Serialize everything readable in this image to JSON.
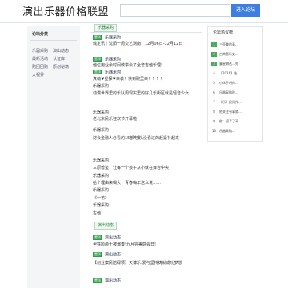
{
  "header": {
    "logo": "演出乐器价格联盟",
    "search_placeholder": "",
    "search_button": "进入论坛"
  },
  "sidebar": {
    "title": "论坛分类",
    "items": [
      "乐器采购",
      "演出动态",
      "最新活动",
      "认证库",
      "赔团团购",
      "原创秘籍",
      "大视界"
    ]
  },
  "section1": {
    "tab": "乐器采购",
    "posts": [
      {
        "tag": "置顶",
        "source": "乐器采购",
        "title": "城定讯｜沈阳一周交艺测南：12月06日-12月12日"
      },
      {
        "tag": "置顶",
        "source": "乐器采购",
        "title": "他位用业余时间教学会了全套吉他乐理!"
      },
      {
        "tag": "置顶",
        "source": "乐器采购",
        "title": "真萌♥星探♥来袭！快到碗里来！！！！"
      },
      {
        "source": "乐器采购",
        "title": "动漫世界里的乐队周现实里的好几乐街区就是轻音少女"
      },
      {
        "source": "乐器采购",
        "title": "老北京民乐狂欢节开幕啦！"
      },
      {
        "source": "乐器采购",
        "title": "财会金融人必看的15部电影,没看过的赶紧补起来"
      },
      {
        "source": "乐器采购",
        "title": "三原兽鉴：让每一个孩子从小就在舞台中央"
      },
      {
        "source": "乐器采购",
        "title": "给个理由来喝大！青春嗨年这么说……"
      },
      {
        "source": "乐器采购",
        "title": "《一苇》"
      },
      {
        "source": "乐器采购",
        "title": "古他"
      }
    ]
  },
  "section2": {
    "tab": "演出动态",
    "posts": [
      {
        "tag": "置顶",
        "source": "演出动态",
        "title": "尹铁颜爵士被演奏!九月完美庭会日!"
      },
      {
        "tag": "置顶",
        "source": "演出动态",
        "title": "【创业案民陪碌颖】天博乐:爱与坚持铸就成功梦想"
      },
      {
        "tag": "置顶",
        "source": "演出动态"
      }
    ]
  },
  "hot": {
    "title": "论坛热议榜",
    "items": [
      {
        "rank": "1",
        "text": "三亚美的青…"
      },
      {
        "rank": "2",
        "text": "古典音乐史…"
      },
      {
        "rank": "3",
        "text": "童星琳达…外"
      },
      {
        "rank": "4",
        "text": "【2016】结…"
      },
      {
        "rank": "5",
        "text": "小伙子听你…"
      },
      {
        "rank": "6",
        "text": "乐器采购现…"
      },
      {
        "rank": "7",
        "text": "【乐】民间作…"
      },
      {
        "rank": "8",
        "text": "他关注有事就…"
      },
      {
        "rank": "9",
        "text": "他：招了了不…"
      },
      {
        "rank": "10",
        "text": "乐器采购…"
      }
    ]
  }
}
